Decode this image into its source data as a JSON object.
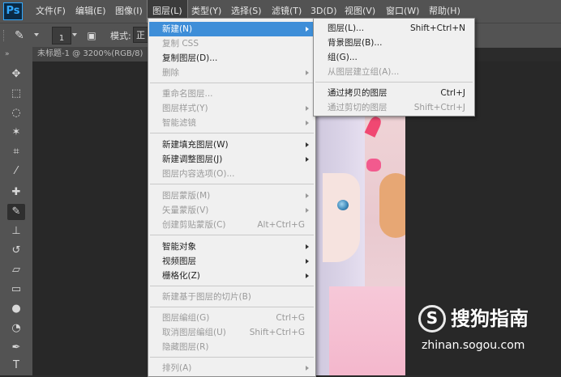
{
  "app": {
    "logo": "Ps"
  },
  "menubar": [
    {
      "label": "文件(F)"
    },
    {
      "label": "编辑(E)"
    },
    {
      "label": "图像(I)"
    },
    {
      "label": "图层(L)"
    },
    {
      "label": "类型(Y)"
    },
    {
      "label": "选择(S)"
    },
    {
      "label": "滤镜(T)"
    },
    {
      "label": "3D(D)"
    },
    {
      "label": "视图(V)"
    },
    {
      "label": "窗口(W)"
    },
    {
      "label": "帮助(H)"
    }
  ],
  "options": {
    "brush_size": "1",
    "mode_label": "模式:",
    "mode_value": "正"
  },
  "document": {
    "tab": "未标题-1 @ 3200%(RGB/8)"
  },
  "layer_menu": {
    "items": [
      {
        "label": "新建(N)",
        "shortcut": ""
      },
      {
        "label": "复制 CSS",
        "shortcut": ""
      },
      {
        "label": "复制图层(D)...",
        "shortcut": ""
      },
      {
        "label": "删除",
        "shortcut": ""
      },
      {
        "label": "重命名图层...",
        "shortcut": ""
      },
      {
        "label": "图层样式(Y)",
        "shortcut": ""
      },
      {
        "label": "智能滤镜",
        "shortcut": ""
      },
      {
        "label": "新建填充图层(W)",
        "shortcut": ""
      },
      {
        "label": "新建调整图层(J)",
        "shortcut": ""
      },
      {
        "label": "图层内容选项(O)...",
        "shortcut": ""
      },
      {
        "label": "图层蒙版(M)",
        "shortcut": ""
      },
      {
        "label": "矢量蒙版(V)",
        "shortcut": ""
      },
      {
        "label": "创建剪贴蒙版(C)",
        "shortcut": "Alt+Ctrl+G"
      },
      {
        "label": "智能对象",
        "shortcut": ""
      },
      {
        "label": "视频图层",
        "shortcut": ""
      },
      {
        "label": "栅格化(Z)",
        "shortcut": ""
      },
      {
        "label": "新建基于图层的切片(B)",
        "shortcut": ""
      },
      {
        "label": "图层编组(G)",
        "shortcut": "Ctrl+G"
      },
      {
        "label": "取消图层编组(U)",
        "shortcut": "Shift+Ctrl+G"
      },
      {
        "label": "隐藏图层(R)",
        "shortcut": ""
      },
      {
        "label": "排列(A)",
        "shortcut": ""
      }
    ]
  },
  "new_submenu": {
    "items": [
      {
        "label": "图层(L)...",
        "shortcut": "Shift+Ctrl+N"
      },
      {
        "label": "背景图层(B)...",
        "shortcut": ""
      },
      {
        "label": "组(G)...",
        "shortcut": ""
      },
      {
        "label": "从图层建立组(A)...",
        "shortcut": ""
      },
      {
        "label": "通过拷贝的图层",
        "shortcut": "Ctrl+J"
      },
      {
        "label": "通过剪切的图层",
        "shortcut": "Shift+Ctrl+J"
      }
    ]
  },
  "watermark": {
    "logo": "S",
    "brand": "搜狗指南",
    "url": "zhinan.sogou.com"
  }
}
